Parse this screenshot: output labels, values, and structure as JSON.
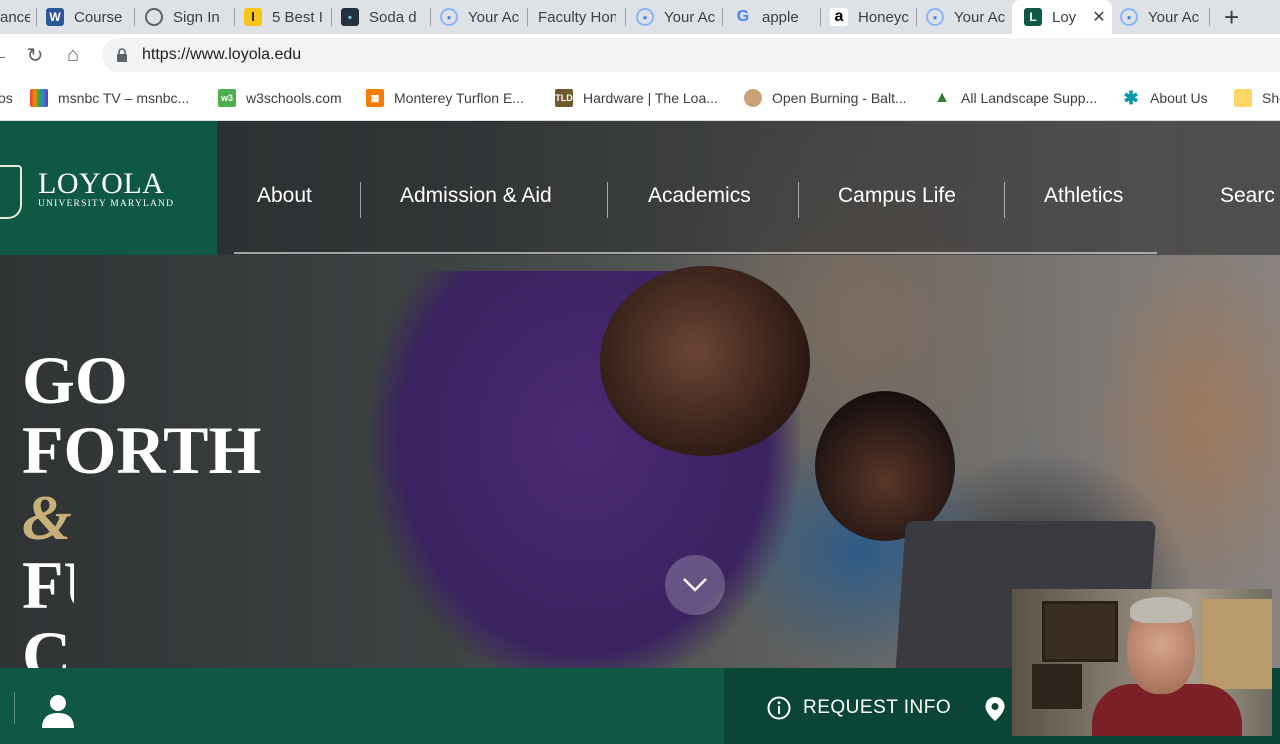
{
  "browser": {
    "tabs": [
      {
        "label": "ance",
        "icon": "page-icon"
      },
      {
        "label": "Course",
        "icon": "word-icon"
      },
      {
        "label": "Sign In",
        "icon": "globe-icon"
      },
      {
        "label": "5 Best I",
        "icon": "l-icon"
      },
      {
        "label": "Soda d",
        "icon": "monster-icon"
      },
      {
        "label": "Your Ac",
        "icon": "circle-icon"
      },
      {
        "label": "Faculty Hon",
        "icon": ""
      },
      {
        "label": "Your Ac",
        "icon": "circle-icon"
      },
      {
        "label": "apple",
        "icon": "google-icon"
      },
      {
        "label": "Honeyc",
        "icon": "amazon-icon"
      },
      {
        "label": "Your Ac",
        "icon": "circle-icon"
      },
      {
        "label": "Loy",
        "icon": "loyola-icon",
        "active": true
      },
      {
        "label": "Your Ac",
        "icon": "circle-icon"
      }
    ],
    "url": "https://www.loyola.edu",
    "bookmarks": [
      {
        "label": "os"
      },
      {
        "label": "msnbc TV – msnbc..."
      },
      {
        "label": "w3schools.com"
      },
      {
        "label": "Monterey Turflon E..."
      },
      {
        "label": "Hardware | The Loa..."
      },
      {
        "label": "Open Burning - Balt..."
      },
      {
        "label": "All Landscape Supp..."
      },
      {
        "label": "About Us"
      },
      {
        "label": "She"
      }
    ]
  },
  "site": {
    "logo": {
      "name": "LOYOLA",
      "subtitle": "UNIVERSITY MARYLAND"
    },
    "nav": [
      "About",
      "Admission & Aid",
      "Academics",
      "Campus Life",
      "Athletics",
      "Searc"
    ],
    "hero": {
      "line1": "GO",
      "line2": "FORTH",
      "amp": "&",
      "line3": "FU",
      "line4": "C"
    },
    "request_info": "REQUEST INFO"
  },
  "colors": {
    "brand_green": "#0f5844",
    "gold": "#c8b07a"
  }
}
